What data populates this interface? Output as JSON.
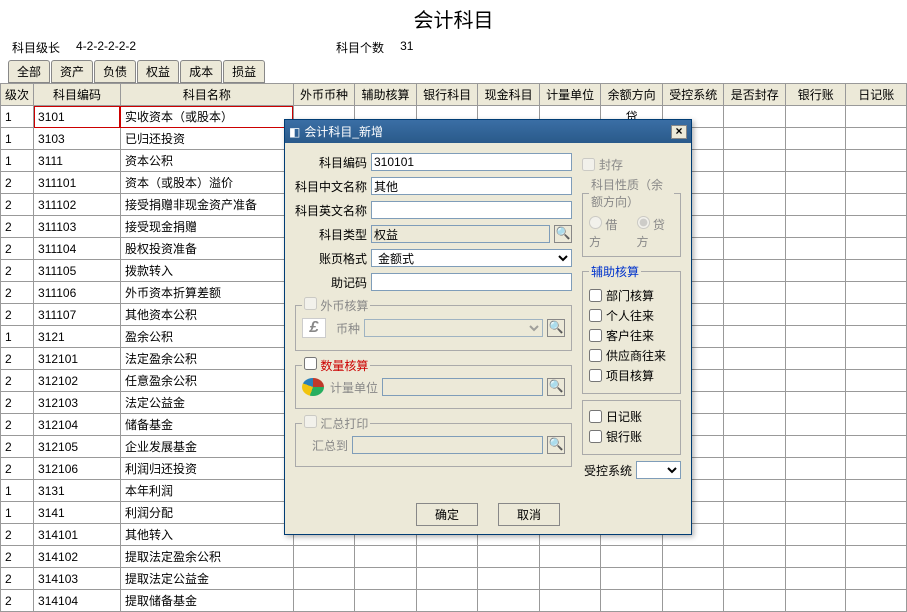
{
  "header": {
    "title": "会计科目"
  },
  "info": {
    "level_label": "科目级长",
    "level_value": "4-2-2-2-2-2",
    "count_label": "科目个数",
    "count_value": "31"
  },
  "tabs": [
    "全部",
    "资产",
    "负债",
    "权益",
    "成本",
    "损益"
  ],
  "columns": [
    "级次",
    "科目编码",
    "科目名称",
    "外币币种",
    "辅助核算",
    "银行科目",
    "现金科目",
    "计量单位",
    "余额方向",
    "受控系统",
    "是否封存",
    "银行账",
    "日记账"
  ],
  "rows": [
    {
      "lvl": "1",
      "code": "3101",
      "name": "实收资本（或股本）",
      "dir": "贷",
      "sel": true
    },
    {
      "lvl": "1",
      "code": "3103",
      "name": "已归还投资",
      "dir": ".."
    },
    {
      "lvl": "1",
      "code": "3111",
      "name": "资本公积"
    },
    {
      "lvl": "2",
      "code": "311101",
      "name": "资本（或股本）溢价"
    },
    {
      "lvl": "2",
      "code": "311102",
      "name": "接受捐赠非现金资产准备"
    },
    {
      "lvl": "2",
      "code": "311103",
      "name": "接受现金捐赠"
    },
    {
      "lvl": "2",
      "code": "311104",
      "name": "股权投资准备"
    },
    {
      "lvl": "2",
      "code": "311105",
      "name": "拨款转入"
    },
    {
      "lvl": "2",
      "code": "311106",
      "name": "外币资本折算差额"
    },
    {
      "lvl": "2",
      "code": "311107",
      "name": "其他资本公积"
    },
    {
      "lvl": "1",
      "code": "3121",
      "name": "盈余公积"
    },
    {
      "lvl": "2",
      "code": "312101",
      "name": "法定盈余公积"
    },
    {
      "lvl": "2",
      "code": "312102",
      "name": "任意盈余公积"
    },
    {
      "lvl": "2",
      "code": "312103",
      "name": "法定公益金"
    },
    {
      "lvl": "2",
      "code": "312104",
      "name": "储备基金"
    },
    {
      "lvl": "2",
      "code": "312105",
      "name": "企业发展基金"
    },
    {
      "lvl": "2",
      "code": "312106",
      "name": "利润归还投资"
    },
    {
      "lvl": "1",
      "code": "3131",
      "name": "本年利润"
    },
    {
      "lvl": "1",
      "code": "3141",
      "name": "利润分配"
    },
    {
      "lvl": "2",
      "code": "314101",
      "name": "其他转入"
    },
    {
      "lvl": "2",
      "code": "314102",
      "name": "提取法定盈余公积"
    },
    {
      "lvl": "2",
      "code": "314103",
      "name": "提取法定公益金"
    },
    {
      "lvl": "2",
      "code": "314104",
      "name": "提取储备基金"
    }
  ],
  "dialog": {
    "title": "会计科目_新增",
    "labels": {
      "code": "科目编码",
      "cname": "科目中文名称",
      "ename": "科目英文名称",
      "type": "科目类型",
      "format": "账页格式",
      "mnemonic": "助记码",
      "currency_grp": "外币核算",
      "currency": "币种",
      "qty_grp": "数量核算",
      "qty": "计量单位",
      "print_grp": "汇总打印",
      "print_to": "汇总到",
      "sealed": "封存",
      "nature_grp": "科目性质（余额方向）",
      "debit": "借方",
      "credit": "贷方",
      "aux_grp": "辅助核算",
      "aux_dept": "部门核算",
      "aux_person": "个人往来",
      "aux_cust": "客户往来",
      "aux_vendor": "供应商往来",
      "aux_project": "项目核算",
      "journal": "日记账",
      "bank": "银行账",
      "ctrl_sys": "受控系统"
    },
    "values": {
      "code": "310101",
      "cname": "其他",
      "ename": "",
      "type": "权益",
      "format": "金额式",
      "mnemonic": "",
      "currency": "",
      "qty": "",
      "print_to": ""
    },
    "buttons": {
      "ok": "确定",
      "cancel": "取消"
    }
  }
}
